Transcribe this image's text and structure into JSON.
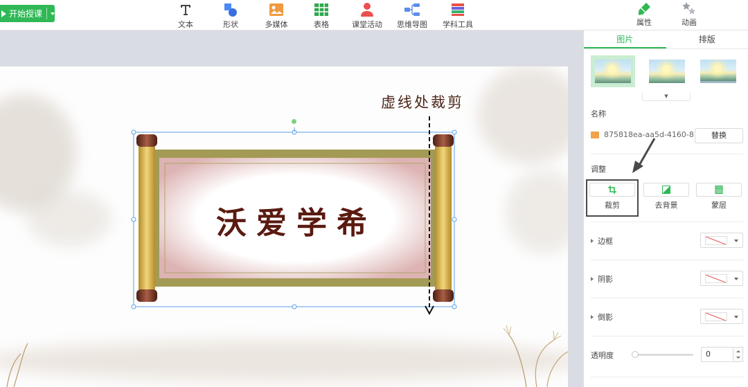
{
  "colors": {
    "accent": "#2fb855",
    "scroll_title": "#5a1a10",
    "dashed_line": "#111111"
  },
  "toolbar": {
    "start_label": "开始授课",
    "items": [
      {
        "icon": "text-icon",
        "label": "文本"
      },
      {
        "icon": "shape-icon",
        "label": "形状"
      },
      {
        "icon": "media-icon",
        "label": "多媒体"
      },
      {
        "icon": "table-icon",
        "label": "表格"
      },
      {
        "icon": "class-activity-icon",
        "label": "课堂活动"
      },
      {
        "icon": "mind-map-icon",
        "label": "思维导图"
      },
      {
        "icon": "subject-tools-icon",
        "label": "学科工具"
      }
    ],
    "right_tabs": [
      {
        "icon": "brush-icon",
        "label": "属性"
      },
      {
        "icon": "stars-icon",
        "label": "动画"
      }
    ]
  },
  "slide": {
    "scroll_title": "沃爱学希",
    "annotation": "虚线处裁剪"
  },
  "panel": {
    "tabs": [
      "图片",
      "排版"
    ],
    "active_tab": "图片",
    "name_label": "名称",
    "file_name": "875818ea-aa5d-4160-8...",
    "replace_label": "替换",
    "adjust_label": "调整",
    "adjust_buttons": [
      "裁剪",
      "去背景",
      "蒙层"
    ],
    "border_label": "边框",
    "shadow_label": "阴影",
    "reflection_label": "倒影",
    "opacity_label": "透明度",
    "opacity_value": "0"
  }
}
